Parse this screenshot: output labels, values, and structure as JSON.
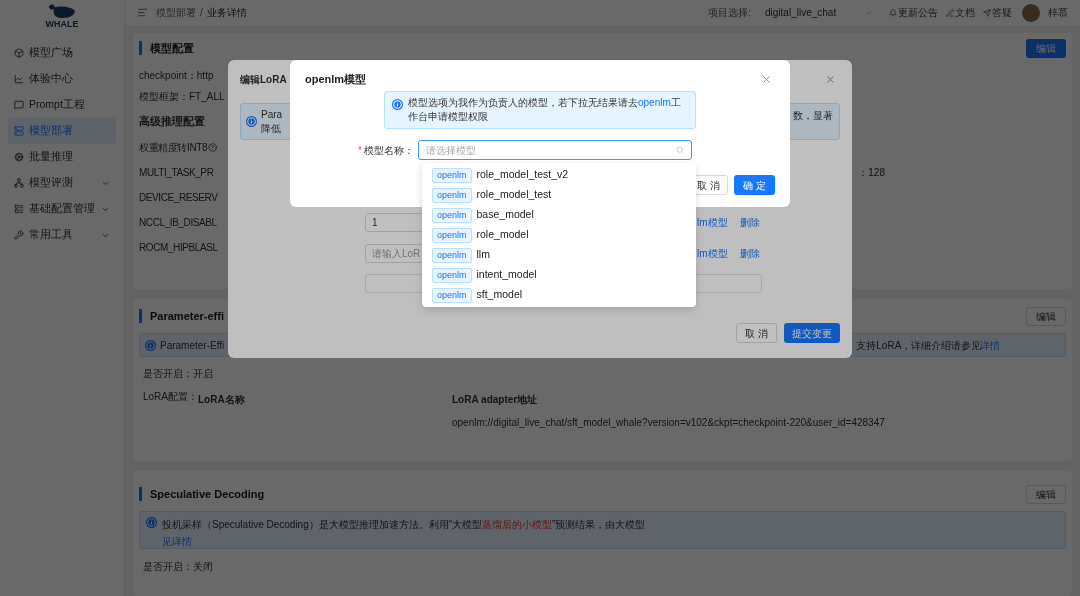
{
  "sidebar": {
    "logo": "WHALE",
    "items": [
      {
        "label": "模型广场",
        "selected": false,
        "expandable": false
      },
      {
        "label": "体验中心",
        "selected": false,
        "expandable": false
      },
      {
        "label": "Prompt工程",
        "selected": false,
        "expandable": false
      },
      {
        "label": "模型部署",
        "selected": true,
        "expandable": false
      },
      {
        "label": "批量推理",
        "selected": false,
        "expandable": false
      },
      {
        "label": "模型评测",
        "selected": false,
        "expandable": true
      },
      {
        "label": "基础配置管理",
        "selected": false,
        "expandable": true
      },
      {
        "label": "常用工具",
        "selected": false,
        "expandable": true
      }
    ]
  },
  "header": {
    "breadcrumb": [
      "模型部署",
      "/",
      "业务详情"
    ],
    "project_label": "项目选择:",
    "project_value": "digital_live_chat",
    "links": [
      "更新公告",
      "文档",
      "答疑"
    ],
    "user": "梓慕"
  },
  "model_config": {
    "title": "模型配置",
    "edit": "编辑",
    "checkpoint": "checkpoint：http",
    "framework": "模型框架：FT_ALL",
    "advanced_title": "高级推理配置",
    "params": [
      "权重精度转INT8",
      "MULTI_TASK_PR",
      "DEVICE_RESERV",
      "NCCL_IB_DISABL",
      "ROCM_HIPBLASL"
    ],
    "side_value": "：128"
  },
  "peft": {
    "title": "Parameter-effi",
    "edit": "编辑",
    "alert_left": "Parameter-Effi",
    "alert_right": "支持LoRA，详细介绍请参见",
    "alert_link": "详情",
    "enabled": "是否开启：开启",
    "lora_label": "LoRA配置：",
    "columns": [
      "LoRA名称",
      "LoRA adapter地址"
    ],
    "rows": [
      {
        "address": "openlm://digital_live_chat/sft_model_whale?version=v102&ckpt=checkpoint-220&user_id=428347"
      }
    ]
  },
  "speculative": {
    "title": "Speculative Decoding",
    "edit": "编辑",
    "alert_before": "投机采样（Speculative Decoding）是大模型推理加速方法。利用“大模型",
    "alert_highlight": "蒸馏后的小模型",
    "alert_after": "”预测结果，由大模型",
    "alert_link": "见详情",
    "enabled": "是否开启：关闭"
  },
  "lora_modal": {
    "title": "编辑LoRA",
    "alert_lines": [
      "Para",
      "降低"
    ],
    "alert_right": "数，显著",
    "rows": [
      {
        "value": "1",
        "link": "lm模型",
        "delete": "删除"
      },
      {
        "placeholder": "请输入LoR",
        "link": "lm模型",
        "delete": "删除"
      }
    ],
    "cancel": "取 消",
    "submit": "提交变更"
  },
  "openlm_modal": {
    "title": "openlm模型",
    "alert_before": "模型选项为我作为负责人的模型，若下拉无结果请去",
    "alert_link": "openlm",
    "alert_after": "工作台申请模型权限",
    "required_mark": "*",
    "field_label": "模型名称：",
    "placeholder": "请选择模型",
    "cancel": "取 消",
    "ok": "确 定",
    "options": [
      {
        "tag": "openlm",
        "name": "role_model_test_v2"
      },
      {
        "tag": "openlm",
        "name": "role_model_test"
      },
      {
        "tag": "openlm",
        "name": "base_model"
      },
      {
        "tag": "openlm",
        "name": "role_model"
      },
      {
        "tag": "openlm",
        "name": "llm"
      },
      {
        "tag": "openlm",
        "name": "intent_model"
      },
      {
        "tag": "openlm",
        "name": "sft_model"
      }
    ]
  }
}
